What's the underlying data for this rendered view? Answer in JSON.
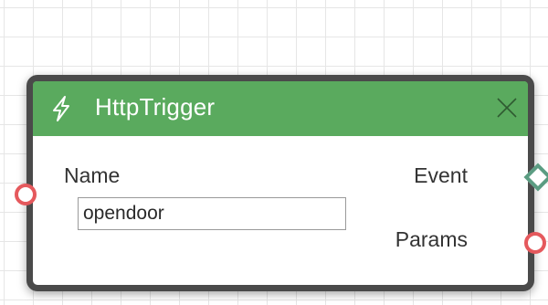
{
  "node": {
    "title": "HttpTrigger",
    "header_color": "#5aaa5e",
    "icon": "lightning-bolt-icon",
    "close_icon": "close-icon",
    "fields": {
      "name_label": "Name",
      "name_value": "opendoor"
    },
    "outputs": {
      "event_label": "Event",
      "params_label": "Params"
    },
    "port_colors": {
      "data_port": "#e5595d",
      "event_port": "#5b9c82"
    }
  }
}
